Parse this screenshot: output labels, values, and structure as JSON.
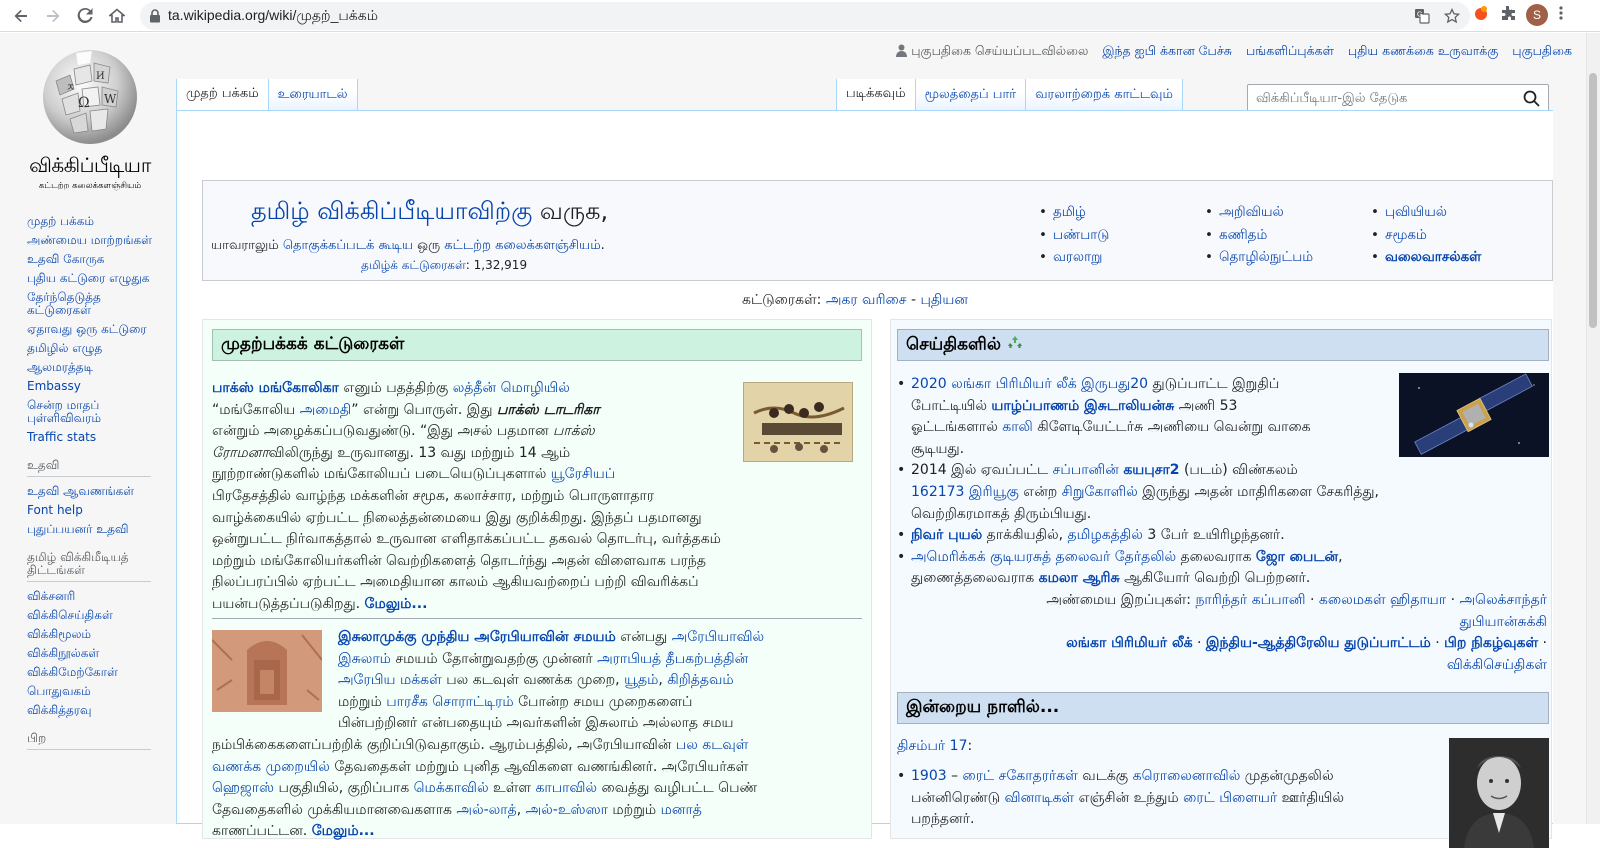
{
  "browser": {
    "url": "ta.wikipedia.org/wiki/முதற்_பக்கம்",
    "avatar_letter": "S"
  },
  "personal": {
    "not_logged_in": "புகுபதிகை செய்யப்படவில்லை",
    "talk": "இந்த ஐபி க்கான பேச்சு",
    "contributions": "பங்களிப்புக்கள்",
    "create_account": "புதிய கணக்கை உருவாக்கு",
    "login": "புகுபதிகை"
  },
  "logo": {
    "title": "விக்கிப்பீடியா",
    "subtitle": "கட்டற்ற கலைக்களஞ்சியம்"
  },
  "sidebar": {
    "main": [
      "முதற் பக்கம்",
      "அண்மைய மாற்றங்கள்",
      "உதவி கோருக",
      "புதிய கட்டுரை எழுதுக",
      "தேர்ந்தெடுத்த கட்டுரைகள்",
      "ஏதாவது ஒரு கட்டுரை",
      "தமிழில் எழுத",
      "ஆலமரத்தடி",
      "Embassy",
      "சென்ற மாதப் புள்ளிவிவரம்",
      "Traffic stats"
    ],
    "help_heading": "உதவி",
    "help": [
      "உதவி ஆவணங்கள்",
      "Font help",
      "புதுப்பயனர் உதவி"
    ],
    "projects_heading": "தமிழ் விக்கிமீடியத் திட்டங்கள்",
    "projects": [
      "விக்சனரி",
      "விக்கிசெய்திகள்",
      "விக்கிமூலம்",
      "விக்கிநூல்கள்",
      "விக்கிமேற்கோள்",
      "பொதுவகம்",
      "விக்கித்தரவு"
    ],
    "other_heading": "பிற"
  },
  "tabs": {
    "page": "முதற் பக்கம்",
    "talk": "உரையாடல்",
    "read": "படிக்கவும்",
    "view_source": "மூலத்தைப் பார்",
    "history": "வரலாற்றைக் காட்டவும்"
  },
  "search": {
    "placeholder": "விக்கிப்பீடியா-இல் தேடுக"
  },
  "welcome": {
    "title_link": "தமிழ் விக்கிப்பீடியாவிற்கு",
    "title_rest": " வருக,",
    "tag_1": "யாவராலும் ",
    "tag_2": "தொகுக்கப்படக் கூடிய",
    "tag_3": " ஒரு ",
    "tag_4": "கட்டற்ற",
    "tag_5": " ",
    "tag_6": "கலைக்களஞ்சியம்",
    "tag_7": ".",
    "count_label": "தமிழ்க் கட்டுரைகள்",
    "count_value": ": 1,32,919",
    "portals_col1": [
      "தமிழ்",
      "பண்பாடு",
      "வரலாறு"
    ],
    "portals_col2": [
      "அறிவியல்",
      "கணிதம்",
      "தொழில்நுட்பம்"
    ],
    "portals_col3": [
      "புவியியல்",
      "சமூகம்",
      "வலைவாசல்கள்"
    ]
  },
  "listing": {
    "label": "கட்டுரைகள்: ",
    "alpha": "அகர வரிசை",
    "sep": " - ",
    "new": "புதியன"
  },
  "featured": {
    "heading": "முதற்பக்கக் கட்டுரைகள்",
    "a1_l1": [
      "பாக்ஸ் மங்கோலிகா",
      " எனும் பதத்திற்கு ",
      "லத்தீன் மொழியில்"
    ],
    "a1_l2": [
      "“மங்கோலிய ",
      "அமைதி",
      "” என்று பொருள். இது ",
      "பாக்ஸ் டாடரிகா"
    ],
    "a1_l3": [
      "என்றும் அழைக்கப்படுவதுண்டு. “இது அசல் பதமான ",
      "பாக்ஸ்"
    ],
    "a1_l4": [
      "ரோமனா",
      "விலிருந்து உருவானது. 13 வது மற்றும் 14 ஆம்"
    ],
    "a1_l5": [
      "நூற்றாண்டுகளில் மங்கோலியப் படையெடுப்புகளால் ",
      "யூரேசியப்"
    ],
    "a1_l6": "பிரதேசத்தில் வாழ்ந்த மக்களின் சமூக, கலாச்சார, மற்றும் பொருளாதார",
    "a1_l7": "வாழ்க்கையில் ஏற்பட்ட நிலைத்தன்மையை இது குறிக்கிறது. இந்தப் பதமானது",
    "a1_l8": "ஒன்றுபட்ட நிர்வாகத்தால் உருவான எளிதாக்கப்பட்ட தகவல் தொடர்பு, வர்த்தகம்",
    "a1_l9": "மற்றும் மங்கோலியர்களின் வெற்றிகளைத் தொடர்ந்து அதன் விளைவாக பரந்த",
    "a1_l10": "நிலப்பரப்பில் ஏற்பட்ட அமைதியான காலம் ஆகியவற்றைப் பற்றி விவரிக்கப்",
    "a1_l11": [
      "பயன்படுத்தப்படுகிறது. ",
      "மேலும்..."
    ],
    "a2_l1": [
      "இசுலாமுக்கு முந்திய அரேபியாவின் சமயம்",
      " என்பது ",
      "அரேபியாவில்"
    ],
    "a2_l2": [
      "இசுலாம்",
      " சமயம் தோன்றுவதற்கு முன்னர் ",
      "அராபியத் தீபகற்பத்தின்"
    ],
    "a2_l3": [
      "அரேபிய மக்கள்",
      " பல கடவுள் வணக்க முறை, ",
      "யூதம்",
      ", ",
      "கிறித்தவம்"
    ],
    "a2_l4": [
      "மற்றும் ",
      "பாரசீக சொராட்டிரம்",
      " போன்ற சமய முறைகளைப்"
    ],
    "a2_l5": "பின்பற்றினர் என்பதையும் அவர்களின் இசுலாம் அல்லாத சமய",
    "a2_l6": [
      "நம்பிக்கைகளைப்பற்றிக் குறிப்பிடுவதாகும். ஆரம்பத்தில், அரேபியாவின் ",
      "பல கடவுள்"
    ],
    "a2_l7": [
      "வணக்க முறையில்",
      " தேவதைகள் மற்றும் புனித ஆவிகளை வணங்கினர். அரேபியர்கள்"
    ],
    "a2_l8": [
      "ஹெஜாஸ்",
      " பகுதியில், குறிப்பாக ",
      "மெக்காவில்",
      " உள்ள ",
      "காபாவில்",
      " வைத்து வழிபட்ட பெண்"
    ],
    "a2_l9": [
      "தேவதைகளில் முக்கியமானவைகளாக ",
      "அல்-லாத்",
      ", ",
      "அல்-உஸ்ஸா",
      " மற்றும் ",
      "மனாத்"
    ],
    "a2_l10": [
      "காணப்பட்டன. ",
      "மேலும்..."
    ]
  },
  "news": {
    "heading": "செய்திகளில்",
    "n1_l1": [
      "2020 லங்கா பிரிமியர் லீக்",
      " ",
      "இருபது20",
      " துடுப்பாட்ட இறுதிப்"
    ],
    "n1_l2": [
      "போட்டியில் ",
      "யாழ்ப்பாணம் இசுடாலியன்சு",
      " அணி 53"
    ],
    "n1_l3": [
      "ஓட்டங்களால் ",
      "காலி",
      " கிளேடியேட்டர்சு அணியை வென்று வாகை"
    ],
    "n1_l4": "சூடியது.",
    "n2_l1": [
      "2014 இல் ஏவப்பட்ட ",
      "சப்பானின்",
      " ",
      "கயபுசா2",
      " (படம்) விண்கலம்"
    ],
    "n2_l2": [
      "162173 இரியூகு",
      " என்ற ",
      "சிறுகோளில்",
      " இருந்து அதன் மாதிரிகளை சேகரித்து,"
    ],
    "n2_l3": "வெற்றிகரமாகத் திரும்பியது.",
    "n3_l1": [
      "நிவர் புயல்",
      " தாக்கியதில், ",
      "தமிழகத்தில்",
      " 3 பேர் உயிரிழந்தனர்."
    ],
    "n4_l1": [
      "அமெரிக்கக் குடியரசுத் தலைவர் தேர்தலில்",
      " தலைவராக ",
      "ஜோ பைடன்",
      ","
    ],
    "n4_l2": [
      "துணைத்தலைவராக ",
      "கமலா ஆரிசு",
      " ஆகியோர் வெற்றி பெற்றனர்."
    ],
    "deaths_label": "அண்மைய இறப்புகள்",
    "deaths": [
      "நாரிந்தர் கப்பானி",
      "கலைமகள் ",
      "ஹிதாயா",
      "அலெக்சாந்தர்"
    ],
    "deaths_l2": "துபியான்சுக்கி",
    "footer": [
      "லங்கா பிரிமியர் லீக்",
      "இந்திய-ஆத்திரேலிய துடுப்பாட்டம்",
      "பிற நிகழ்வுகள்"
    ],
    "footer_l2": "விக்கிசெய்திகள்"
  },
  "otd": {
    "heading": "இன்றைய நாளில்...",
    "date": "திசம்பர் 17",
    "date_suffix": ":",
    "e1_l1": [
      "1903",
      " – ",
      "ரைட் சகோதரர்கள்",
      " வடக்கு ",
      "கரொலைனாவில்",
      " முதன்முதலில்"
    ],
    "e1_l2": [
      "பன்னிரெண்டு ",
      "வினாடிகள்",
      " எஞ்சின் உந்தும் ",
      "ரைட் பிளையர்",
      " ஊர்தியில்"
    ],
    "e1_l3": "பறந்தனர்."
  }
}
